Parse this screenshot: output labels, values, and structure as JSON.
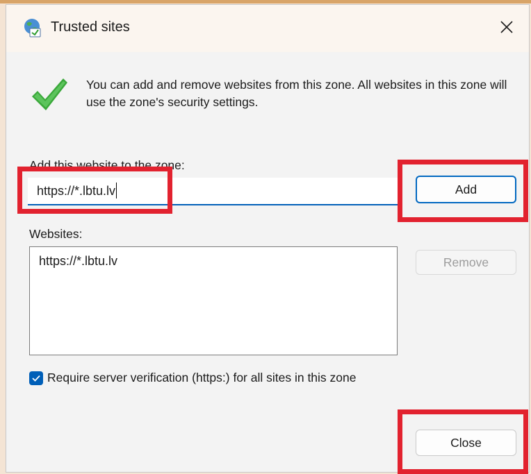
{
  "window": {
    "title": "Trusted sites",
    "close_icon": "close-icon"
  },
  "description": "You can add and remove websites from this zone. All websites in this zone will use the zone's security settings.",
  "add_section": {
    "label": "Add this website to the zone:",
    "input_value": "https://*.lbtu.lv",
    "add_button": "Add"
  },
  "websites_section": {
    "label": "Websites:",
    "items": [
      "https://*.lbtu.lv"
    ],
    "remove_button": "Remove"
  },
  "require_verification": {
    "checked": true,
    "label": "Require server verification (https:) for all sites in this zone"
  },
  "close_button": "Close",
  "colors": {
    "accent": "#005fb8",
    "check_green": "#3aa83a",
    "highlight_red": "#e2222f"
  }
}
